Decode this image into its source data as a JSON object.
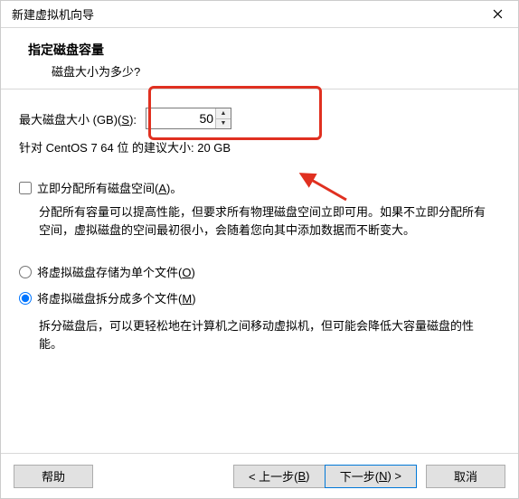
{
  "window": {
    "title": "新建虚拟机向导"
  },
  "header": {
    "title": "指定磁盘容量",
    "subtitle": "磁盘大小为多少?"
  },
  "disk": {
    "label_prefix": "最大磁盘大小 (GB)(",
    "label_hotkey": "S",
    "label_suffix": "):",
    "value": "50",
    "recommend": "针对 CentOS 7 64 位 的建议大小: 20 GB"
  },
  "allocate": {
    "label_prefix": "立即分配所有磁盘空间(",
    "label_hotkey": "A",
    "label_suffix": ")。",
    "desc": "分配所有容量可以提高性能，但要求所有物理磁盘空间立即可用。如果不立即分配所有空间，虚拟磁盘的空间最初很小，会随着您向其中添加数据而不断变大。"
  },
  "split": {
    "single_prefix": "将虚拟磁盘存储为单个文件(",
    "single_hotkey": "O",
    "single_suffix": ")",
    "multi_prefix": "将虚拟磁盘拆分成多个文件(",
    "multi_hotkey": "M",
    "multi_suffix": ")",
    "desc": "拆分磁盘后，可以更轻松地在计算机之间移动虚拟机，但可能会降低大容量磁盘的性能。"
  },
  "buttons": {
    "help": "帮助",
    "back_prefix": "< 上一步(",
    "back_hotkey": "B",
    "back_suffix": ")",
    "next_prefix": "下一步(",
    "next_hotkey": "N",
    "next_suffix": ") >",
    "cancel": "取消"
  }
}
